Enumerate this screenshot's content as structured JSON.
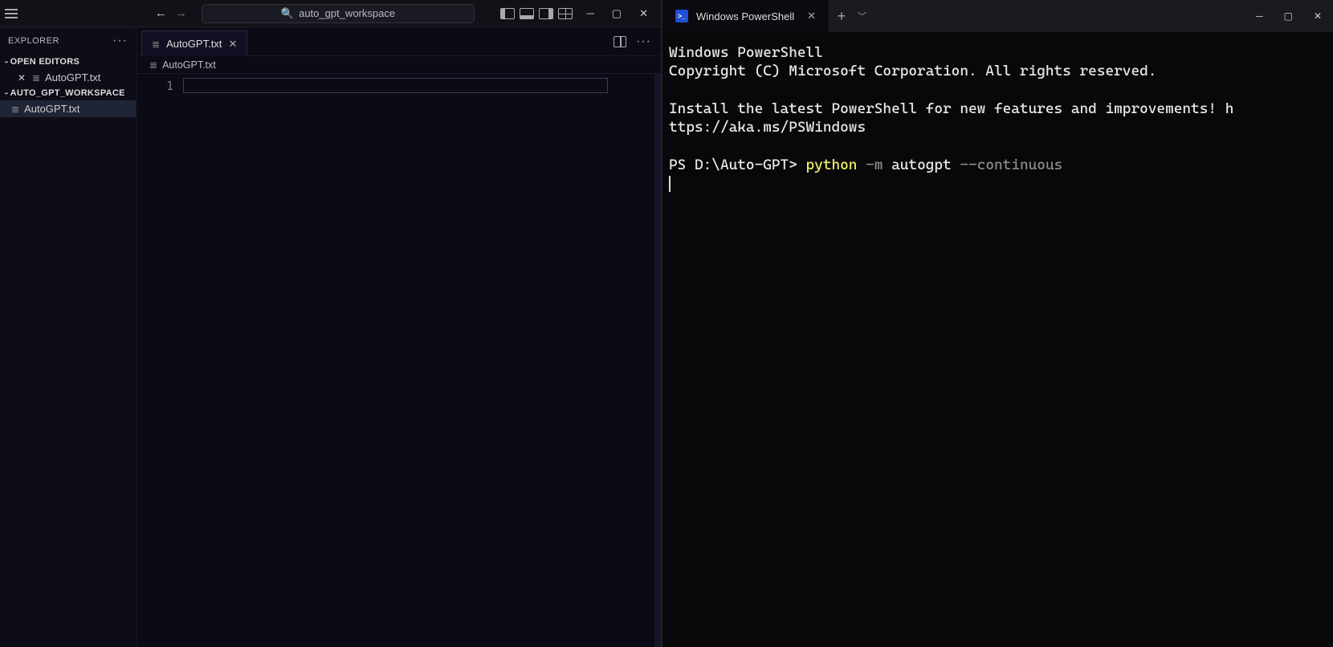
{
  "vscode": {
    "command_center_text": "auto_gpt_workspace",
    "explorer_label": "EXPLORER",
    "open_editors_label": "OPEN EDITORS",
    "workspace_label": "AUTO_GPT_WORKSPACE",
    "open_editors": [
      {
        "name": "AutoGPT.txt"
      }
    ],
    "workspace_files": [
      {
        "name": "AutoGPT.txt"
      }
    ],
    "tabs": [
      {
        "label": "AutoGPT.txt"
      }
    ],
    "breadcrumb": "AutoGPT.txt",
    "gutter_line_1": "1"
  },
  "terminal": {
    "tab_title": "Windows PowerShell",
    "line1": "Windows PowerShell",
    "line2": "Copyright (C) Microsoft Corporation. All rights reserved.",
    "line3a": "Install the latest PowerShell for new features and improvements! h",
    "line3b": "ttps://aka.ms/PSWindows",
    "prompt": "PS D:\\Auto-GPT> ",
    "cmd_exe": "python",
    "cmd_m": " -m ",
    "cmd_mod": "autogpt",
    "cmd_flag": " --continuous"
  }
}
